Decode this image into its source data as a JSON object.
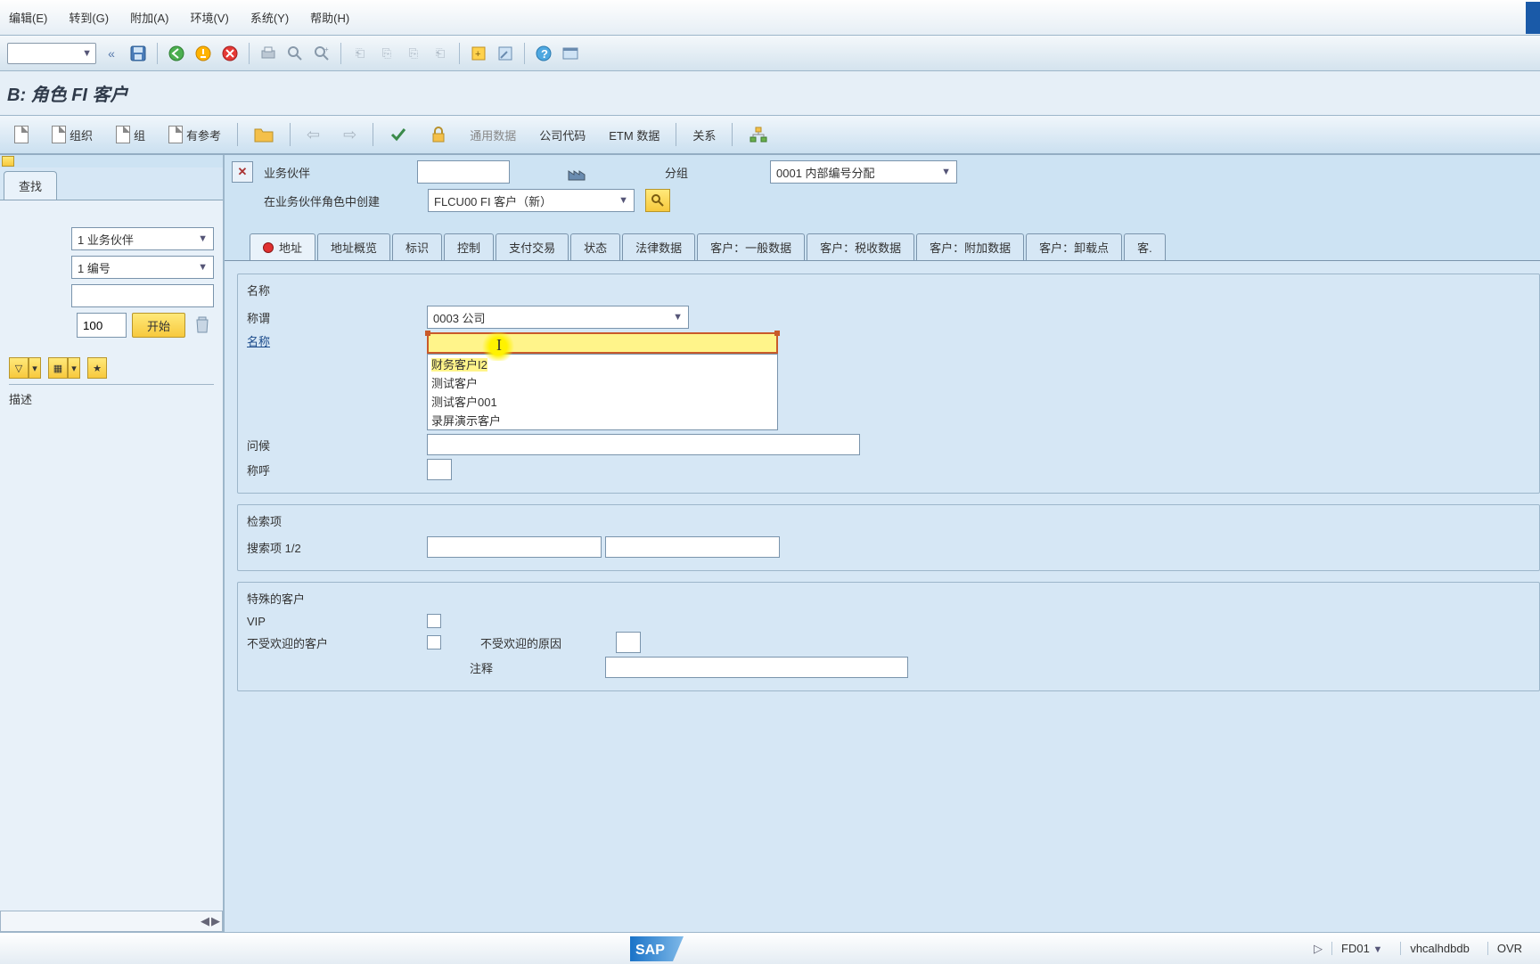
{
  "menu": {
    "edit": "编辑(E)",
    "goto": "转到(G)",
    "attach": "附加(A)",
    "env": "环境(V)",
    "system": "系统(Y)",
    "help": "帮助(H)"
  },
  "title": "B: 角色 FI 客户",
  "sub_toolbar": {
    "org": "组织",
    "group": "组",
    "ref": "有参考",
    "common_data": "通用数据",
    "company_code": "公司代码",
    "etm_data": "ETM 数据",
    "relation": "关系"
  },
  "header": {
    "partner_label": "业务伙伴",
    "group_label": "分组",
    "group_value": "0001 内部编号分配",
    "role_create_label": "在业务伙伴角色中创建",
    "role_value": "FLCU00 FI 客户（新）"
  },
  "left": {
    "tab_find": "查找",
    "sel1": "1 业务伙伴",
    "sel2": "1 编号",
    "num_value": "100",
    "btn_start": "开始",
    "desc": "描述"
  },
  "tabs": [
    "地址",
    "地址概览",
    "标识",
    "控制",
    "支付交易",
    "状态",
    "法律数据",
    "客户：一般数据",
    "客户：税收数据",
    "客户：附加数据",
    "客户：卸载点",
    "客."
  ],
  "groups": {
    "name": {
      "title": "名称",
      "salutation_label": "称谓",
      "salutation_value": "0003 公司",
      "name_label": "名称",
      "suggestions": [
        "财务客户I2",
        "测试客户",
        "测试客户001",
        "录屏演示客户"
      ],
      "greeting_label": "问候",
      "address_label": "称呼"
    },
    "search": {
      "title": "检索项",
      "search12_label": "搜索项 1/2"
    },
    "special": {
      "title": "特殊的客户",
      "vip_label": "VIP",
      "unwelcome_label": "不受欢迎的客户",
      "unwelcome_reason_label": "不受欢迎的原因",
      "note_label": "注释"
    }
  },
  "status": {
    "tcode": "FD01",
    "system": "vhcalhdbdb",
    "mode": "OVR"
  },
  "colors": {
    "accent_yellow": "#fff48a",
    "accent_border": "#c95a2a"
  }
}
